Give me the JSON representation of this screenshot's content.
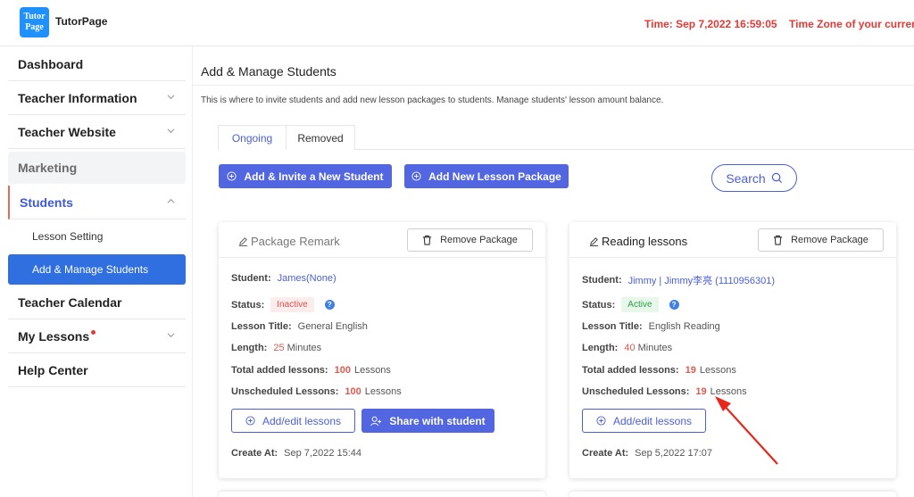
{
  "header": {
    "logo_line1": "Tutor",
    "logo_line2": "Page",
    "brand": "TutorPage",
    "time": "Time: Sep 7,2022 16:59:05",
    "timezone": "Time Zone of your current location"
  },
  "sidebar": {
    "items": [
      {
        "label": "Dashboard"
      },
      {
        "label": "Teacher Information"
      },
      {
        "label": "Teacher Website"
      },
      {
        "label": "Marketing"
      },
      {
        "label": "Students"
      },
      {
        "label": "Lesson Setting"
      },
      {
        "label": "Add & Manage Students"
      },
      {
        "label": "Teacher Calendar"
      },
      {
        "label": "My Lessons"
      },
      {
        "label": "Help Center"
      }
    ]
  },
  "main": {
    "title": "Add & Manage Students",
    "description": "This is where to invite students and add new lesson packages to students. Manage students' lesson amount balance.",
    "tabs": [
      {
        "label": "Ongoing"
      },
      {
        "label": "Removed"
      }
    ],
    "add_invite_label": "Add & Invite a New Student",
    "add_package_label": "Add New Lesson Package",
    "search_label": "Search"
  },
  "fields": {
    "student": "Student:",
    "status": "Status:",
    "lesson_title": "Lesson Title:",
    "length": "Length:",
    "minutes": "Minutes",
    "total_added": "Total added lessons:",
    "unscheduled": "Unscheduled Lessons:",
    "lessons_unit": "Lessons",
    "create_at": "Create At:",
    "remove_package": "Remove Package",
    "add_edit_lessons": "Add/edit lessons",
    "share_with_student": "Share with student"
  },
  "cards": [
    {
      "title": "Package Remark",
      "student": "James(None)",
      "status": "Inactive",
      "lesson_title": "General English",
      "length": "25",
      "total_added": "100",
      "unscheduled": "100",
      "create_at": "Sep 7,2022 15:44"
    },
    {
      "title": "Reading lessons",
      "student": "Jimmy | Jimmy李亮 (1110956301)",
      "status": "Active",
      "lesson_title": "English Reading",
      "length": "40",
      "total_added": "19",
      "unscheduled": "19",
      "create_at": "Sep 5,2022 17:07"
    }
  ],
  "colors": {
    "primary": "#5166e0",
    "time_red": "#e53935",
    "number_red": "#e05a4f",
    "active_green": "#2e9e48",
    "arrow_red": "#e8261c"
  }
}
